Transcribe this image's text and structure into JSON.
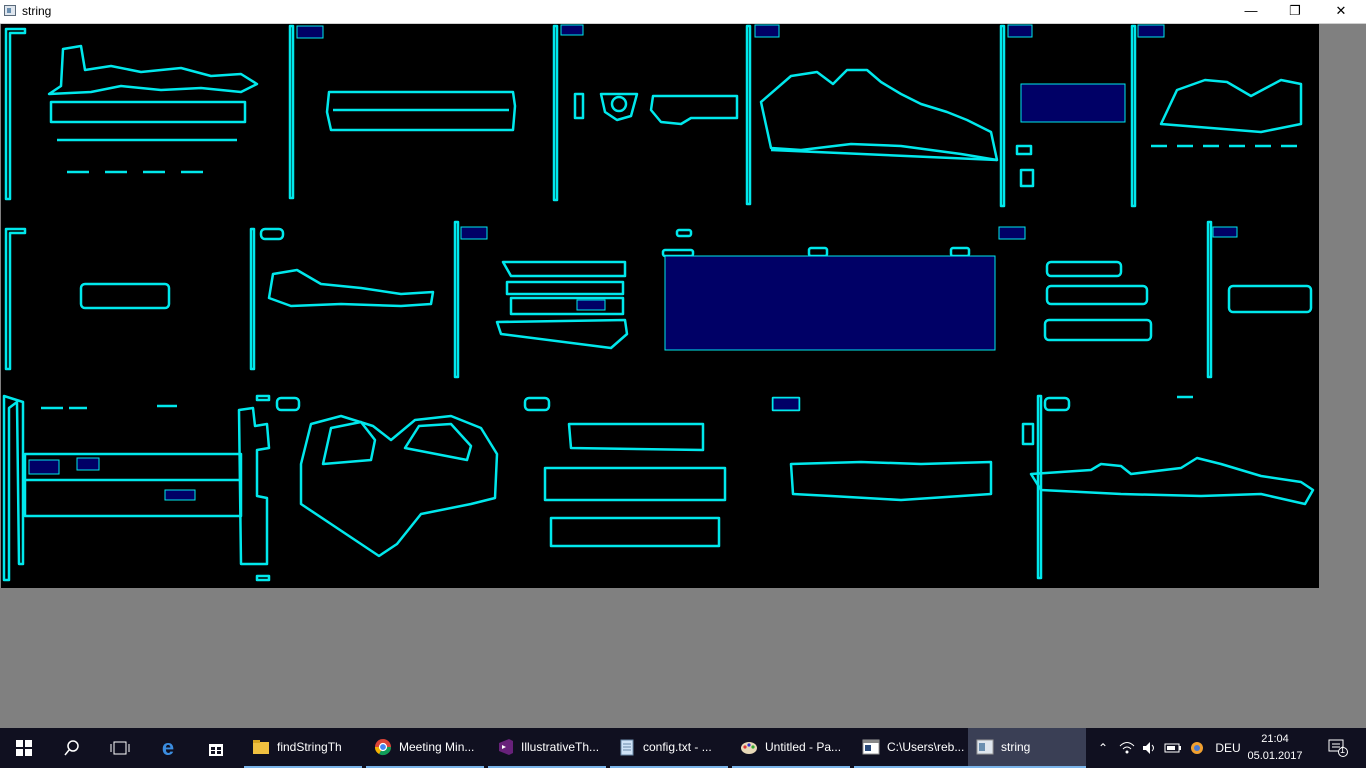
{
  "window": {
    "title": "string",
    "buttons": {
      "minimize": "—",
      "restore": "❐",
      "close": "✕"
    }
  },
  "colors": {
    "contour": "#00e8ec",
    "box_fill": "#000066",
    "canvas_bg": "#000000",
    "desktop_bg": "#808080",
    "taskbar_bg": "#101020"
  },
  "taskbar": {
    "apps": [
      {
        "label": "findStringTh",
        "icon": "folder-icon"
      },
      {
        "label": "Meeting Min...",
        "icon": "chrome-icon"
      },
      {
        "label": "IllustrativeTh...",
        "icon": "visual-studio-icon"
      },
      {
        "label": "config.txt - ...",
        "icon": "notepad-icon"
      },
      {
        "label": "Untitled - Pa...",
        "icon": "paint-icon"
      },
      {
        "label": "C:\\Users\\reb...",
        "icon": "console-icon"
      },
      {
        "label": "string",
        "icon": "app-window-icon"
      }
    ],
    "tray": {
      "language": "DEU",
      "notification_count": "1"
    },
    "clock": {
      "time": "21:04",
      "date": "05.01.2017"
    }
  }
}
